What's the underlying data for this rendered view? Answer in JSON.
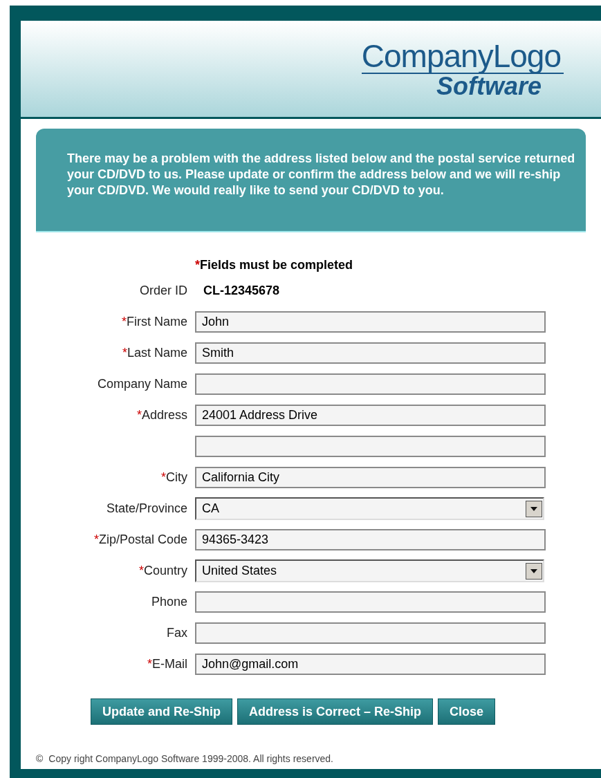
{
  "logo": {
    "name": "CompanyLogo",
    "tagline": "Software"
  },
  "notice": "There may be a problem with the address listed below and the postal service returned your CD/DVD to us. Please update or confirm the address below and we will re-ship your CD/DVD. We would really like to send your CD/DVD to you.",
  "required_mark": "*",
  "required_note": "Fields must be completed",
  "fields": [
    {
      "kind": "static",
      "label": "Order ID",
      "required": false,
      "value": "CL-12345678"
    },
    {
      "kind": "text",
      "label": "First Name",
      "required": true,
      "value": "John"
    },
    {
      "kind": "text",
      "label": "Last Name",
      "required": true,
      "value": "Smith"
    },
    {
      "kind": "text",
      "label": "Company Name",
      "required": false
    },
    {
      "kind": "text",
      "label": "Address",
      "required": true,
      "value": "24001 Address Drive"
    },
    {
      "kind": "text"
    },
    {
      "kind": "text",
      "label": "City",
      "required": true,
      "value": "California City"
    },
    {
      "kind": "select",
      "label": "State/Province",
      "required": false,
      "value": "CA"
    },
    {
      "kind": "text",
      "label": "Zip/Postal Code",
      "required": true,
      "value": "94365-3423"
    },
    {
      "kind": "select",
      "label": "Country",
      "required": true,
      "value": "United States"
    },
    {
      "kind": "text",
      "label": "Phone",
      "required": false
    },
    {
      "kind": "text",
      "label": "Fax",
      "required": false
    },
    {
      "kind": "text",
      "label": "E-Mail",
      "required": true,
      "value": "John@gmail.com"
    }
  ],
  "buttons": [
    "Update and Re-Ship",
    "Address is Correct – Re-Ship",
    "Close"
  ],
  "footer": {
    "symbol": "©",
    "text": "Copy right CompanyLogo Software 1999-2008. All rights reserved."
  }
}
